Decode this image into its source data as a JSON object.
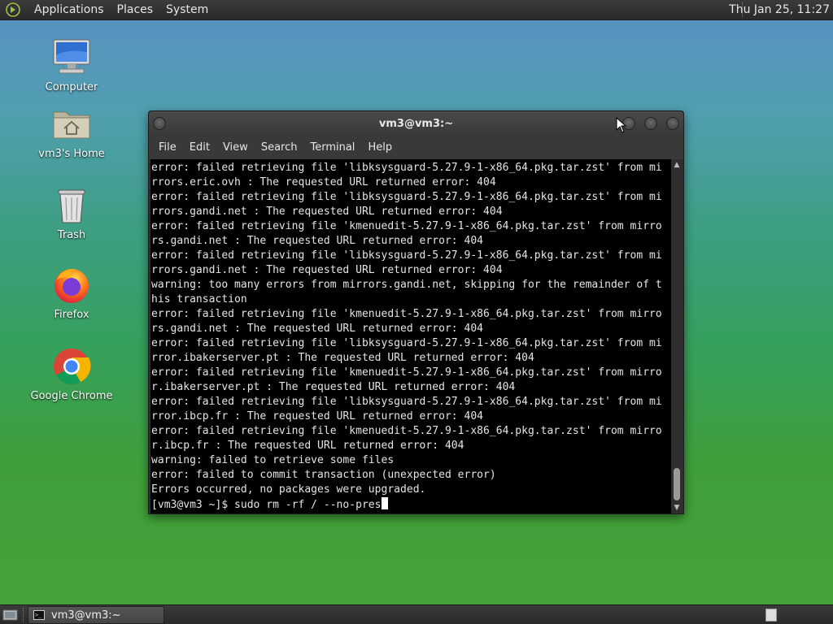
{
  "top_panel": {
    "menus": [
      "Applications",
      "Places",
      "System"
    ],
    "clock": "Thu Jan 25, 11:27"
  },
  "desktop_icons": [
    {
      "label": "Computer",
      "icon": "computer-icon"
    },
    {
      "label": "vm3's Home",
      "icon": "home-folder-icon"
    },
    {
      "label": "Trash",
      "icon": "trash-icon"
    },
    {
      "label": "Firefox",
      "icon": "firefox-icon"
    },
    {
      "label": "Google Chrome",
      "icon": "chrome-icon"
    }
  ],
  "terminal": {
    "title": "vm3@vm3:~",
    "menus": [
      "File",
      "Edit",
      "View",
      "Search",
      "Terminal",
      "Help"
    ],
    "lines": [
      "error: failed retrieving file 'libksysguard-5.27.9-1-x86_64.pkg.tar.zst' from mi",
      "rrors.eric.ovh : The requested URL returned error: 404",
      "error: failed retrieving file 'libksysguard-5.27.9-1-x86_64.pkg.tar.zst' from mi",
      "rrors.gandi.net : The requested URL returned error: 404",
      "error: failed retrieving file 'kmenuedit-5.27.9-1-x86_64.pkg.tar.zst' from mirro",
      "rs.gandi.net : The requested URL returned error: 404",
      "error: failed retrieving file 'libksysguard-5.27.9-1-x86_64.pkg.tar.zst' from mi",
      "rrors.gandi.net : The requested URL returned error: 404",
      "warning: too many errors from mirrors.gandi.net, skipping for the remainder of t",
      "his transaction",
      "error: failed retrieving file 'kmenuedit-5.27.9-1-x86_64.pkg.tar.zst' from mirro",
      "rs.gandi.net : The requested URL returned error: 404",
      "error: failed retrieving file 'libksysguard-5.27.9-1-x86_64.pkg.tar.zst' from mi",
      "rror.ibakerserver.pt : The requested URL returned error: 404",
      "error: failed retrieving file 'kmenuedit-5.27.9-1-x86_64.pkg.tar.zst' from mirro",
      "r.ibakerserver.pt : The requested URL returned error: 404",
      "error: failed retrieving file 'libksysguard-5.27.9-1-x86_64.pkg.tar.zst' from mi",
      "rror.ibcp.fr : The requested URL returned error: 404",
      "error: failed retrieving file 'kmenuedit-5.27.9-1-x86_64.pkg.tar.zst' from mirro",
      "r.ibcp.fr : The requested URL returned error: 404",
      "warning: failed to retrieve some files",
      "error: failed to commit transaction (unexpected error)",
      "Errors occurred, no packages were upgraded."
    ],
    "prompt": "[vm3@vm3 ~]$ ",
    "command_input": "sudo rm -rf / --no-pres"
  },
  "taskbar": {
    "task_label": "vm3@vm3:~"
  }
}
